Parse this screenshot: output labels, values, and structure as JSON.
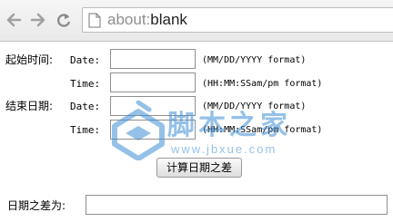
{
  "browser": {
    "url_scheme": "about:",
    "url_rest": "blank",
    "back_icon": "back-arrow-icon",
    "forward_icon": "forward-arrow-icon",
    "reload_icon": "reload-icon",
    "page_icon": "page-icon"
  },
  "form": {
    "start": {
      "label": "起始时间:",
      "date_label": "Date:",
      "date_value": "",
      "date_hint": "(MM/DD/YYYY format)",
      "time_label": "Time:",
      "time_value": "",
      "time_hint": "(HH:MM:SSam/pm format)"
    },
    "end": {
      "label": "结束日期:",
      "date_label": "Date:",
      "date_value": "",
      "date_hint": "(MM/DD/YYYY format)",
      "time_label": "Time:",
      "time_value": "",
      "time_hint": "(HH:MM:SSam/pm format)"
    },
    "calc_button": "计算日期之差",
    "result_label": "日期之差为:",
    "result_value": ""
  },
  "watermark": {
    "text": "脚本之家",
    "url": "www.jbxue.com"
  },
  "colors": {
    "watermark": "#3f8fd6",
    "toolbar_bg": "#efefef"
  }
}
